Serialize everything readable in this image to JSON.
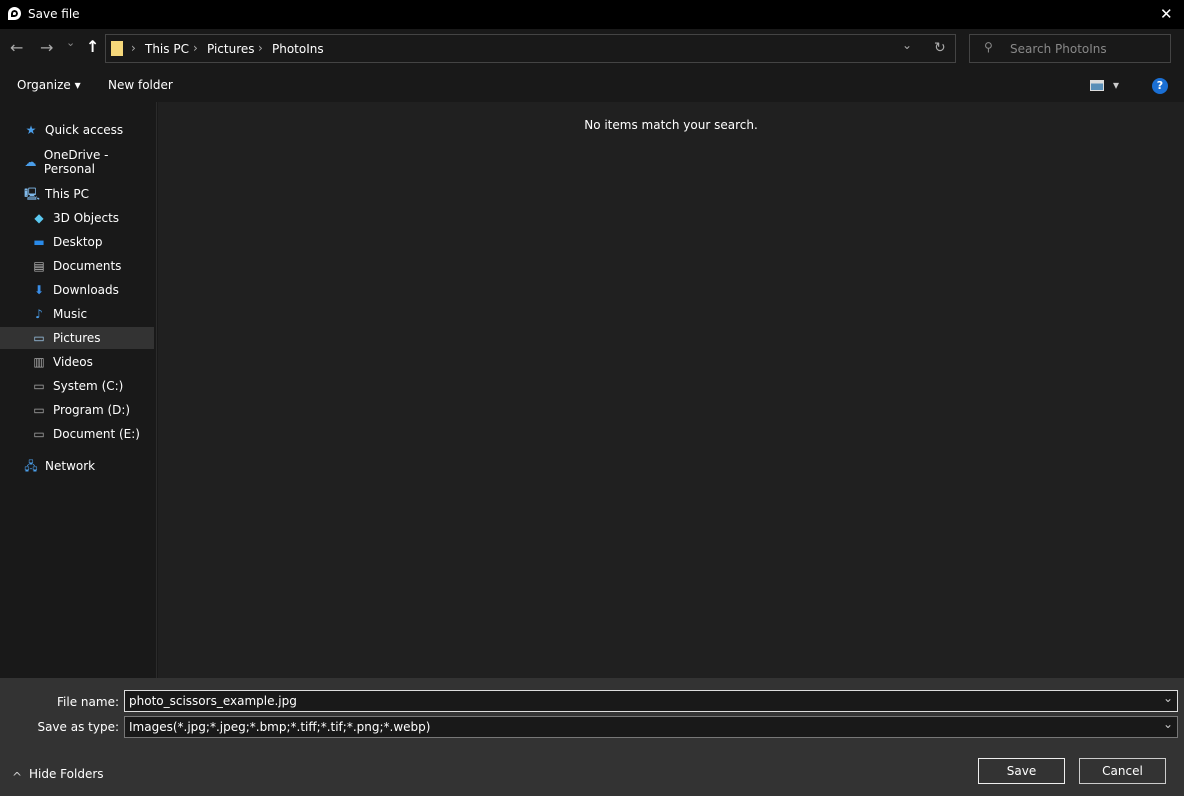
{
  "window": {
    "title": "Save file",
    "close": "✕"
  },
  "nav": {
    "back": "←",
    "forward": "→",
    "recent": "⌄",
    "up": "↑",
    "breadcrumb": [
      "This PC",
      "Pictures",
      "PhotoIns"
    ],
    "separator": "›",
    "dropdown": "⌄",
    "refresh": "↻",
    "search_placeholder": "Search PhotoIns"
  },
  "toolbar": {
    "organize": "Organize ▾",
    "new_folder": "New folder",
    "view_arrow": "▾",
    "help": "?"
  },
  "sidebar": {
    "items": [
      {
        "label": "Quick access",
        "icon": "star-icon",
        "glyph": "★",
        "color": "#4a9de8"
      },
      {
        "label": "OneDrive - Personal",
        "icon": "cloud-icon",
        "glyph": "☁",
        "color": "#4a9de8"
      },
      {
        "label": "This PC",
        "icon": "computer-icon",
        "glyph": "🖳",
        "color": "#7fb8e8"
      },
      {
        "label": "3D Objects",
        "icon": "cube-icon",
        "glyph": "◆",
        "color": "#5bc8f0"
      },
      {
        "label": "Desktop",
        "icon": "desktop-icon",
        "glyph": "▬",
        "color": "#2a8ae8"
      },
      {
        "label": "Documents",
        "icon": "document-icon",
        "glyph": "▤",
        "color": "#bbbbbb"
      },
      {
        "label": "Downloads",
        "icon": "download-icon",
        "glyph": "⬇",
        "color": "#3a8ee8"
      },
      {
        "label": "Music",
        "icon": "music-icon",
        "glyph": "♪",
        "color": "#4a9de8"
      },
      {
        "label": "Pictures",
        "icon": "pictures-icon",
        "glyph": "▭",
        "color": "#9ec8e8"
      },
      {
        "label": "Videos",
        "icon": "video-icon",
        "glyph": "▥",
        "color": "#aaaaaa"
      },
      {
        "label": "System (C:)",
        "icon": "drive-icon",
        "glyph": "▭",
        "color": "#aaaaaa"
      },
      {
        "label": "Program (D:)",
        "icon": "drive-icon",
        "glyph": "▭",
        "color": "#aaaaaa"
      },
      {
        "label": "Document (E:)",
        "icon": "drive-icon",
        "glyph": "▭",
        "color": "#aaaaaa"
      },
      {
        "label": "Network",
        "icon": "network-icon",
        "glyph": "🖧",
        "color": "#4a9de8"
      }
    ]
  },
  "main": {
    "empty_message": "No items match your search."
  },
  "form": {
    "file_name_label": "File name:",
    "file_name_value": "photo_scissors_example.jpg",
    "type_label": "Save as type:",
    "type_value": "Images(*.jpg;*.jpeg;*.bmp;*.tiff;*.tif;*.png;*.webp)",
    "dropdown": "⌄"
  },
  "footer": {
    "hide_folders": "Hide Folders",
    "chevron": "^",
    "save": "Save",
    "cancel": "Cancel"
  }
}
